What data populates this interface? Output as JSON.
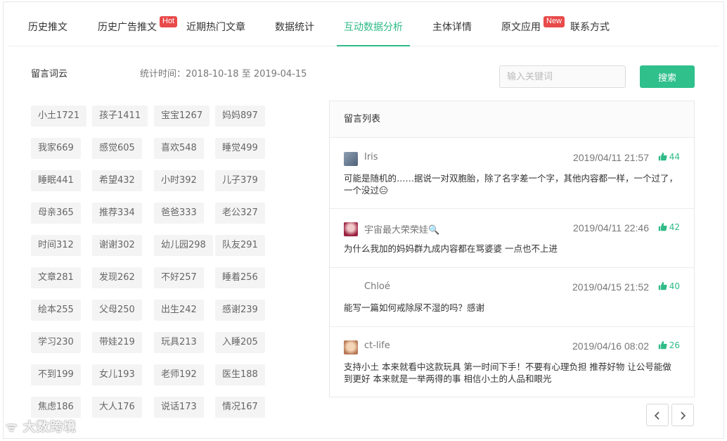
{
  "tabs": [
    {
      "label": "历史推文",
      "active": false
    },
    {
      "label": "历史广告推文",
      "active": false,
      "badge": "Hot"
    },
    {
      "label": "近期热门文章",
      "active": false
    },
    {
      "label": "数据统计",
      "active": false
    },
    {
      "label": "互动数据分析",
      "active": true
    },
    {
      "label": "主体详情",
      "active": false
    },
    {
      "label": "原文应用",
      "active": false,
      "badge": "New"
    },
    {
      "label": "联系方式",
      "active": false
    }
  ],
  "section": {
    "title": "留言词云",
    "stat_time": "统计时间：2018-10-18 至 2019-04-15"
  },
  "search": {
    "placeholder": "输入关键词",
    "value": "",
    "button": "搜索"
  },
  "word_cloud": [
    [
      "小土1721",
      "孩子1411",
      "宝宝1267",
      "妈妈897"
    ],
    [
      "我家669",
      "感觉605",
      "喜欢548",
      "睡觉499"
    ],
    [
      "睡眠441",
      "希望432",
      "小时392",
      "儿子379"
    ],
    [
      "母亲365",
      "推荐334",
      "爸爸333",
      "老公327"
    ],
    [
      "时间312",
      "谢谢302",
      "幼儿园298",
      "队友291"
    ],
    [
      "文章281",
      "发现262",
      "不好257",
      "睡着256"
    ],
    [
      "绘本255",
      "父母250",
      "出生242",
      "感谢239"
    ],
    [
      "学习230",
      "带娃219",
      "玩具213",
      "入睡205"
    ],
    [
      "不到199",
      "女儿193",
      "老师192",
      "医生188"
    ],
    [
      "焦虑186",
      "大人176",
      "说话173",
      "情况167"
    ]
  ],
  "comments": {
    "title": "留言列表",
    "items": [
      {
        "name": "Iris",
        "date": "2019/04/11 21:57",
        "likes": "44",
        "text": "可能是随机的……据说一对双胞胎，除了名字差一个字，其他内容都一样，一个过了，一个没过😑",
        "avatar_color": "#6a7f95"
      },
      {
        "name": "宇宙最大荣荣娃🔍",
        "date": "2019/04/11 22:46",
        "likes": "42",
        "text": "为什么我加的妈妈群九成内容都在骂婆婆 一点也不上进",
        "avatar_color": "#b0304a"
      },
      {
        "name": "Chloé",
        "date": "2019/04/15 21:52",
        "likes": "40",
        "text": "能写一篇如何戒除尿不湿的吗？感谢",
        "avatar_color": ""
      },
      {
        "name": "ct-life",
        "date": "2019/04/16 08:02",
        "likes": "26",
        "text": "支持小土 本来就看中这款玩具 第一时间下手！不要有心理负担 推荐好物 让公号能做到更好 本来就是一举两得的事 相信小土的人品和眼光",
        "avatar_color": "#c98a6a"
      }
    ]
  },
  "watermark": "大数跨境",
  "colors": {
    "accent": "#2fbb87",
    "badge": "#e84a4a"
  }
}
